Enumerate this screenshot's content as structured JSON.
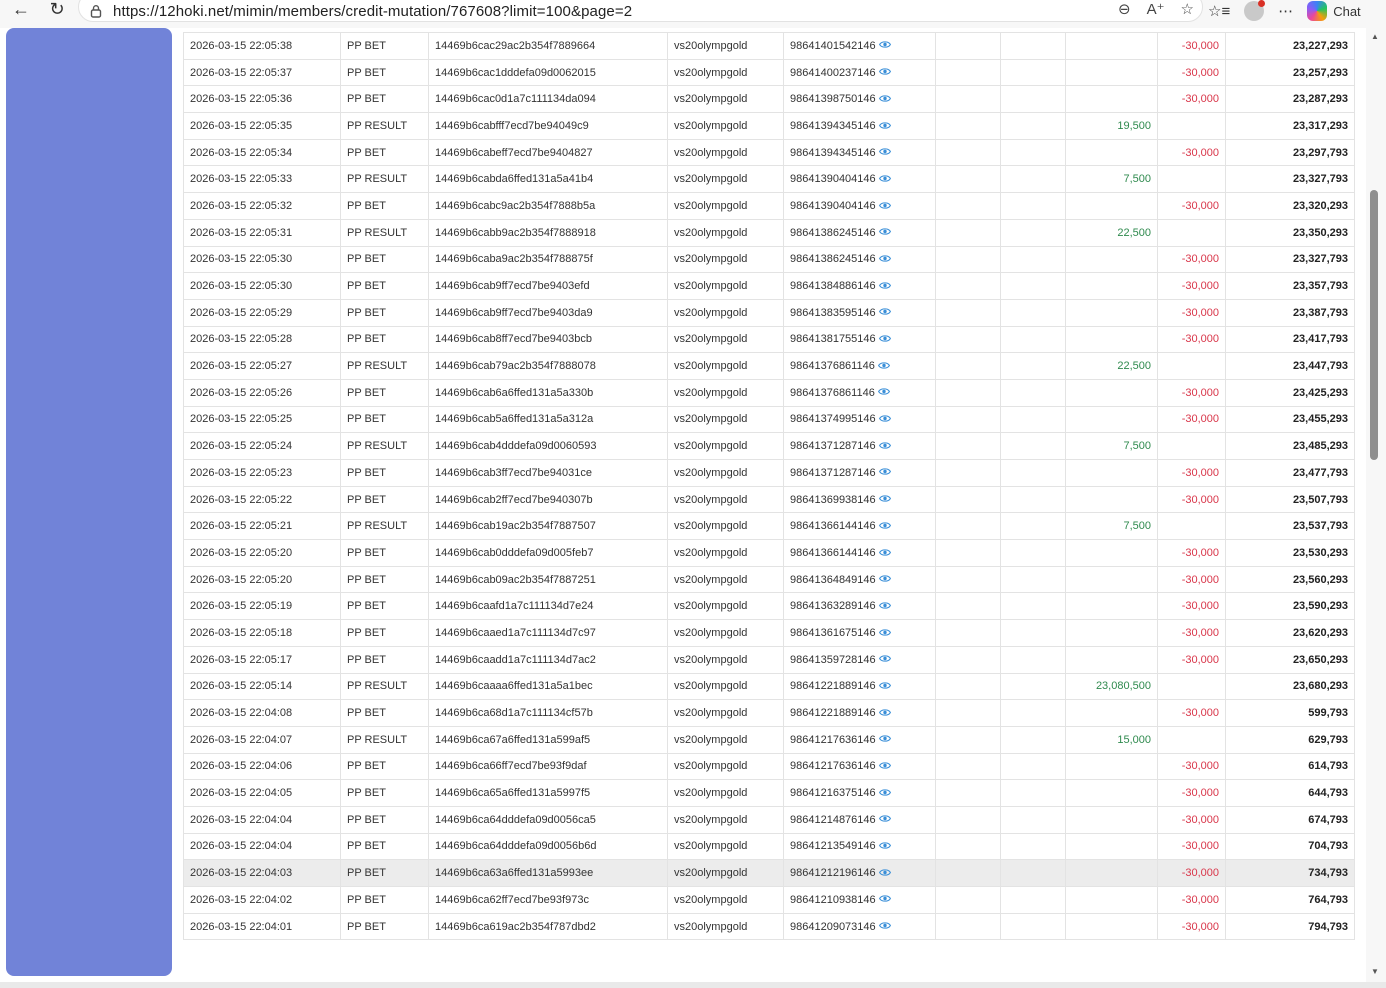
{
  "browser": {
    "url": "https://12hoki.net/mimin/members/credit-mutation/767608?limit=100&page=2",
    "chat_label": "Chat",
    "colors": {
      "sidebar": "#7183d8",
      "credit": "#2f8a4e",
      "debit": "#d9364a"
    },
    "icons": [
      "back-arrow-icon",
      "refresh-icon",
      "lock-icon",
      "zoom-out-icon",
      "read-aloud-icon",
      "favorite-star-icon",
      "favorites-list-icon",
      "profile-avatar",
      "more-options-icon",
      "copilot-icon",
      "eye-icon"
    ]
  },
  "rows": [
    {
      "date": "2026-03-15 22:05:38",
      "type": "PP BET",
      "trx": "14469b6cac29ac2b354f7889664",
      "game": "vs20olympgold",
      "round": "98641401542146",
      "credit": "",
      "debit": "-30,000",
      "balance": "23,227,293"
    },
    {
      "date": "2026-03-15 22:05:37",
      "type": "PP BET",
      "trx": "14469b6cac1dddefa09d0062015",
      "game": "vs20olympgold",
      "round": "98641400237146",
      "credit": "",
      "debit": "-30,000",
      "balance": "23,257,293"
    },
    {
      "date": "2026-03-15 22:05:36",
      "type": "PP BET",
      "trx": "14469b6cac0d1a7c111134da094",
      "game": "vs20olympgold",
      "round": "98641398750146",
      "credit": "",
      "debit": "-30,000",
      "balance": "23,287,293"
    },
    {
      "date": "2026-03-15 22:05:35",
      "type": "PP RESULT",
      "trx": "14469b6cabfff7ecd7be94049c9",
      "game": "vs20olympgold",
      "round": "98641394345146",
      "credit": "19,500",
      "debit": "",
      "balance": "23,317,293"
    },
    {
      "date": "2026-03-15 22:05:34",
      "type": "PP BET",
      "trx": "14469b6cabeff7ecd7be9404827",
      "game": "vs20olympgold",
      "round": "98641394345146",
      "credit": "",
      "debit": "-30,000",
      "balance": "23,297,793"
    },
    {
      "date": "2026-03-15 22:05:33",
      "type": "PP RESULT",
      "trx": "14469b6cabda6ffed131a5a41b4",
      "game": "vs20olympgold",
      "round": "98641390404146",
      "credit": "7,500",
      "debit": "",
      "balance": "23,327,793"
    },
    {
      "date": "2026-03-15 22:05:32",
      "type": "PP BET",
      "trx": "14469b6cabc9ac2b354f7888b5a",
      "game": "vs20olympgold",
      "round": "98641390404146",
      "credit": "",
      "debit": "-30,000",
      "balance": "23,320,293"
    },
    {
      "date": "2026-03-15 22:05:31",
      "type": "PP RESULT",
      "trx": "14469b6cabb9ac2b354f7888918",
      "game": "vs20olympgold",
      "round": "98641386245146",
      "credit": "22,500",
      "debit": "",
      "balance": "23,350,293"
    },
    {
      "date": "2026-03-15 22:05:30",
      "type": "PP BET",
      "trx": "14469b6caba9ac2b354f788875f",
      "game": "vs20olympgold",
      "round": "98641386245146",
      "credit": "",
      "debit": "-30,000",
      "balance": "23,327,793"
    },
    {
      "date": "2026-03-15 22:05:30",
      "type": "PP BET",
      "trx": "14469b6cab9ff7ecd7be9403efd",
      "game": "vs20olympgold",
      "round": "98641384886146",
      "credit": "",
      "debit": "-30,000",
      "balance": "23,357,793"
    },
    {
      "date": "2026-03-15 22:05:29",
      "type": "PP BET",
      "trx": "14469b6cab9ff7ecd7be9403da9",
      "game": "vs20olympgold",
      "round": "98641383595146",
      "credit": "",
      "debit": "-30,000",
      "balance": "23,387,793"
    },
    {
      "date": "2026-03-15 22:05:28",
      "type": "PP BET",
      "trx": "14469b6cab8ff7ecd7be9403bcb",
      "game": "vs20olympgold",
      "round": "98641381755146",
      "credit": "",
      "debit": "-30,000",
      "balance": "23,417,793"
    },
    {
      "date": "2026-03-15 22:05:27",
      "type": "PP RESULT",
      "trx": "14469b6cab79ac2b354f7888078",
      "game": "vs20olympgold",
      "round": "98641376861146",
      "credit": "22,500",
      "debit": "",
      "balance": "23,447,793"
    },
    {
      "date": "2026-03-15 22:05:26",
      "type": "PP BET",
      "trx": "14469b6cab6a6ffed131a5a330b",
      "game": "vs20olympgold",
      "round": "98641376861146",
      "credit": "",
      "debit": "-30,000",
      "balance": "23,425,293"
    },
    {
      "date": "2026-03-15 22:05:25",
      "type": "PP BET",
      "trx": "14469b6cab5a6ffed131a5a312a",
      "game": "vs20olympgold",
      "round": "98641374995146",
      "credit": "",
      "debit": "-30,000",
      "balance": "23,455,293"
    },
    {
      "date": "2026-03-15 22:05:24",
      "type": "PP RESULT",
      "trx": "14469b6cab4dddefa09d0060593",
      "game": "vs20olympgold",
      "round": "98641371287146",
      "credit": "7,500",
      "debit": "",
      "balance": "23,485,293"
    },
    {
      "date": "2026-03-15 22:05:23",
      "type": "PP BET",
      "trx": "14469b6cab3ff7ecd7be94031ce",
      "game": "vs20olympgold",
      "round": "98641371287146",
      "credit": "",
      "debit": "-30,000",
      "balance": "23,477,793"
    },
    {
      "date": "2026-03-15 22:05:22",
      "type": "PP BET",
      "trx": "14469b6cab2ff7ecd7be940307b",
      "game": "vs20olympgold",
      "round": "98641369938146",
      "credit": "",
      "debit": "-30,000",
      "balance": "23,507,793"
    },
    {
      "date": "2026-03-15 22:05:21",
      "type": "PP RESULT",
      "trx": "14469b6cab19ac2b354f7887507",
      "game": "vs20olympgold",
      "round": "98641366144146",
      "credit": "7,500",
      "debit": "",
      "balance": "23,537,793"
    },
    {
      "date": "2026-03-15 22:05:20",
      "type": "PP BET",
      "trx": "14469b6cab0dddefa09d005feb7",
      "game": "vs20olympgold",
      "round": "98641366144146",
      "credit": "",
      "debit": "-30,000",
      "balance": "23,530,293"
    },
    {
      "date": "2026-03-15 22:05:20",
      "type": "PP BET",
      "trx": "14469b6cab09ac2b354f7887251",
      "game": "vs20olympgold",
      "round": "98641364849146",
      "credit": "",
      "debit": "-30,000",
      "balance": "23,560,293"
    },
    {
      "date": "2026-03-15 22:05:19",
      "type": "PP BET",
      "trx": "14469b6caafd1a7c111134d7e24",
      "game": "vs20olympgold",
      "round": "98641363289146",
      "credit": "",
      "debit": "-30,000",
      "balance": "23,590,293"
    },
    {
      "date": "2026-03-15 22:05:18",
      "type": "PP BET",
      "trx": "14469b6caaed1a7c111134d7c97",
      "game": "vs20olympgold",
      "round": "98641361675146",
      "credit": "",
      "debit": "-30,000",
      "balance": "23,620,293"
    },
    {
      "date": "2026-03-15 22:05:17",
      "type": "PP BET",
      "trx": "14469b6caadd1a7c111134d7ac2",
      "game": "vs20olympgold",
      "round": "98641359728146",
      "credit": "",
      "debit": "-30,000",
      "balance": "23,650,293"
    },
    {
      "date": "2026-03-15 22:05:14",
      "type": "PP RESULT",
      "trx": "14469b6caaaa6ffed131a5a1bec",
      "game": "vs20olympgold",
      "round": "98641221889146",
      "credit": "23,080,500",
      "debit": "",
      "balance": "23,680,293"
    },
    {
      "date": "2026-03-15 22:04:08",
      "type": "PP BET",
      "trx": "14469b6ca68d1a7c111134cf57b",
      "game": "vs20olympgold",
      "round": "98641221889146",
      "credit": "",
      "debit": "-30,000",
      "balance": "599,793"
    },
    {
      "date": "2026-03-15 22:04:07",
      "type": "PP RESULT",
      "trx": "14469b6ca67a6ffed131a599af5",
      "game": "vs20olympgold",
      "round": "98641217636146",
      "credit": "15,000",
      "debit": "",
      "balance": "629,793"
    },
    {
      "date": "2026-03-15 22:04:06",
      "type": "PP BET",
      "trx": "14469b6ca66ff7ecd7be93f9daf",
      "game": "vs20olympgold",
      "round": "98641217636146",
      "credit": "",
      "debit": "-30,000",
      "balance": "614,793"
    },
    {
      "date": "2026-03-15 22:04:05",
      "type": "PP BET",
      "trx": "14469b6ca65a6ffed131a5997f5",
      "game": "vs20olympgold",
      "round": "98641216375146",
      "credit": "",
      "debit": "-30,000",
      "balance": "644,793"
    },
    {
      "date": "2026-03-15 22:04:04",
      "type": "PP BET",
      "trx": "14469b6ca64dddefa09d0056ca5",
      "game": "vs20olympgold",
      "round": "98641214876146",
      "credit": "",
      "debit": "-30,000",
      "balance": "674,793"
    },
    {
      "date": "2026-03-15 22:04:04",
      "type": "PP BET",
      "trx": "14469b6ca64dddefa09d0056b6d",
      "game": "vs20olympgold",
      "round": "98641213549146",
      "credit": "",
      "debit": "-30,000",
      "balance": "704,793"
    },
    {
      "date": "2026-03-15 22:04:03",
      "type": "PP BET",
      "trx": "14469b6ca63a6ffed131a5993ee",
      "game": "vs20olympgold",
      "round": "98641212196146",
      "credit": "",
      "debit": "-30,000",
      "balance": "734,793",
      "hover": true
    },
    {
      "date": "2026-03-15 22:04:02",
      "type": "PP BET",
      "trx": "14469b6ca62ff7ecd7be93f973c",
      "game": "vs20olympgold",
      "round": "98641210938146",
      "credit": "",
      "debit": "-30,000",
      "balance": "764,793"
    },
    {
      "date": "2026-03-15 22:04:01",
      "type": "PP BET",
      "trx": "14469b6ca619ac2b354f787dbd2",
      "game": "vs20olympgold",
      "round": "98641209073146",
      "credit": "",
      "debit": "-30,000",
      "balance": "794,793"
    }
  ]
}
